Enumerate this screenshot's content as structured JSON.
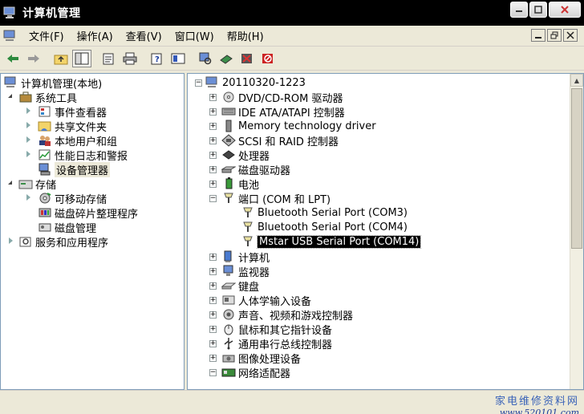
{
  "window": {
    "title": "计算机管理"
  },
  "menubar": {
    "items": [
      "文件(F)",
      "操作(A)",
      "查看(V)",
      "窗口(W)",
      "帮助(H)"
    ]
  },
  "toolbar": {
    "buttons": [
      "back-arrow-icon",
      "forward-arrow-icon",
      "up-folder-icon",
      "show-hide-tree-icon",
      "properties-icon",
      "print-icon",
      "help-icon",
      "console-icon",
      "scan-hardware-icon",
      "update-driver-icon",
      "disable-device-icon",
      "uninstall-device-icon"
    ]
  },
  "left_tree": {
    "root": "计算机管理(本地)",
    "system_tools": "系统工具",
    "event_viewer": "事件查看器",
    "shared_folders": "共享文件夹",
    "local_users": "本地用户和组",
    "perf_logs": "性能日志和警报",
    "device_manager": "设备管理器",
    "storage": "存储",
    "removable_storage": "可移动存储",
    "defrag": "磁盘碎片整理程序",
    "disk_mgmt": "磁盘管理",
    "services_apps": "服务和应用程序"
  },
  "right_tree": {
    "computer_name": "20110320-1223",
    "items": [
      "DVD/CD-ROM 驱动器",
      "IDE ATA/ATAPI 控制器",
      "Memory technology driver",
      "SCSI 和 RAID 控制器",
      "处理器",
      "磁盘驱动器",
      "电池",
      "端口 (COM 和 LPT)",
      "Bluetooth Serial Port (COM3)",
      "Bluetooth Serial Port (COM4)",
      "Mstar USB Serial Port (COM14)",
      "计算机",
      "监视器",
      "键盘",
      "人体学输入设备",
      "声音、视频和游戏控制器",
      "鼠标和其它指针设备",
      "通用串行总线控制器",
      "图像处理设备",
      "网络适配器"
    ]
  },
  "watermark": {
    "line1": "家电维修资料网",
    "line2": "www.520101.com"
  }
}
